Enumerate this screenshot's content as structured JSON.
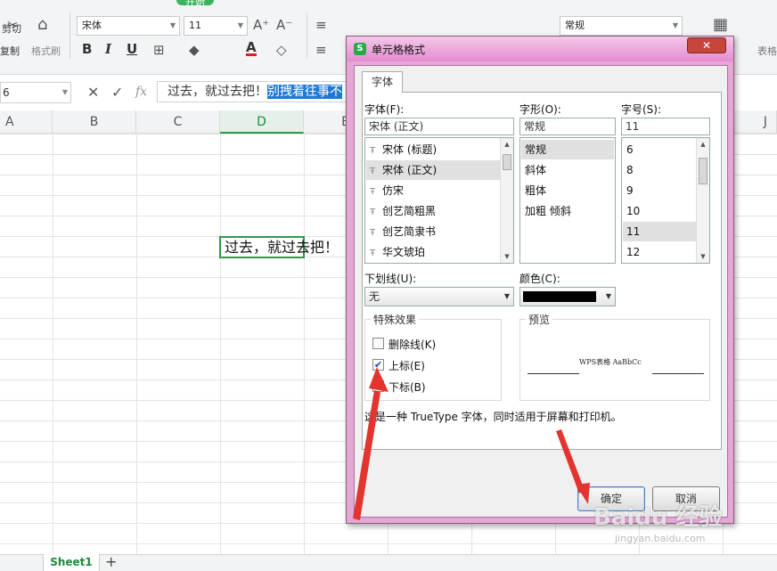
{
  "ribbon": {
    "tabs": [
      "开始"
    ],
    "cut_label": "剪切",
    "copy_label": "复制",
    "format_painter_label": "格式刷",
    "font_name": "宋体",
    "font_size": "11",
    "number_format": "常规",
    "style_label": "表格",
    "grow_font_icon": "A⁺",
    "shrink_font_icon": "A⁻",
    "bold_icon": "B",
    "italic_icon": "I",
    "underline_icon": "U",
    "font_color_icon": "A",
    "brand_color": "#2e9a4a"
  },
  "formula_bar": {
    "name_box": "6",
    "cancel_icon": "✕",
    "confirm_icon": "✓",
    "fx_icon": "fx",
    "text_plain": "过去，就过去把！",
    "text_selected": "别拽着往事不"
  },
  "grid": {
    "columns": [
      "A",
      "B",
      "C",
      "D",
      "E",
      "J"
    ],
    "active_column": "D",
    "cell_text": "过去，就过去把！"
  },
  "sheets": {
    "tabs": [
      "Sheet1"
    ],
    "add_icon": "+"
  },
  "dialog": {
    "title": "单元格格式",
    "close_icon": "✕",
    "tab_font": "字体",
    "font_label": "字体(F):",
    "font_value": "宋体 (正文)",
    "font_list": [
      "宋体 (标题)",
      "宋体 (正文)",
      "仿宋",
      "创艺简粗黑",
      "创艺简隶书",
      "华文琥珀"
    ],
    "font_selected_index": 1,
    "style_label": "字形(O):",
    "style_value": "常规",
    "style_list": [
      "常规",
      "斜体",
      "粗体",
      "加粗 倾斜"
    ],
    "style_selected_index": 0,
    "size_label": "字号(S):",
    "size_value": "11",
    "size_list": [
      "6",
      "8",
      "9",
      "10",
      "11",
      "12"
    ],
    "size_selected_index": 4,
    "underline_label": "下划线(U):",
    "underline_value": "无",
    "color_label": "颜色(C):",
    "color_value": "#000000",
    "effects_title": "特殊效果",
    "strikethrough_label": "删除线(K)",
    "superscript_label": "上标(E)",
    "subscript_label": "下标(B)",
    "strikethrough_checked": false,
    "superscript_checked": true,
    "subscript_checked": false,
    "preview_title": "预览",
    "preview_text": "WPS表格  AaBbCc",
    "info_text": "这是一种 TrueType 字体，同时适用于屏幕和打印机。",
    "ok_label": "确定",
    "cancel_label": "取消"
  },
  "watermark": {
    "brand": "Baidu 经验",
    "url": "jingyan.baidu.com"
  }
}
